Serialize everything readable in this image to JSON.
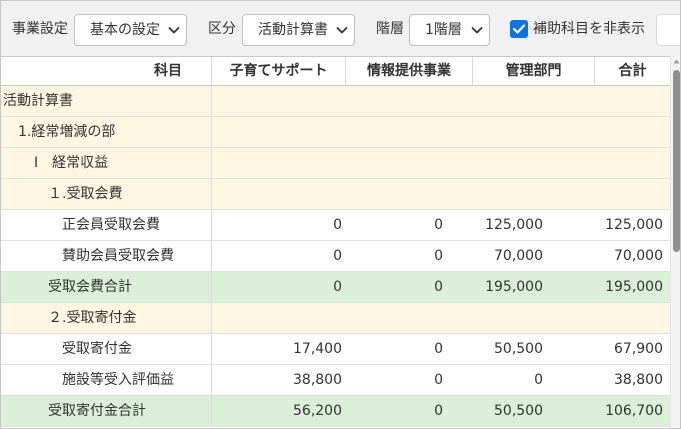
{
  "toolbar": {
    "business_setting": {
      "label": "事業設定",
      "value": "基本の設定"
    },
    "category": {
      "label": "区分",
      "value": "活動計算書"
    },
    "level": {
      "label": "階層",
      "value": "1階層"
    },
    "hide_sub_accounts": {
      "label": "補助科目を非表示",
      "checked": true
    }
  },
  "table": {
    "columns": [
      "科目",
      "子育てサポート",
      "情報提供事業",
      "管理部門",
      "合計"
    ],
    "rows": [
      {
        "label": "活動計算書"
      },
      {
        "label": "1.経常増減の部"
      },
      {
        "label": "Ⅰ　経常収益"
      },
      {
        "label": "１.受取会費"
      },
      {
        "label": "正会員受取会費",
        "values": [
          "0",
          "0",
          "125,000",
          "125,000"
        ]
      },
      {
        "label": "賛助会員受取会費",
        "values": [
          "0",
          "0",
          "70,000",
          "70,000"
        ]
      },
      {
        "label": "受取会費合計",
        "values": [
          "0",
          "0",
          "195,000",
          "195,000"
        ]
      },
      {
        "label": "２.受取寄付金"
      },
      {
        "label": "受取寄付金",
        "values": [
          "17,400",
          "0",
          "50,500",
          "67,900"
        ]
      },
      {
        "label": "施設等受入評価益",
        "values": [
          "38,800",
          "0",
          "0",
          "38,800"
        ]
      },
      {
        "label": "受取寄付金合計",
        "values": [
          "56,200",
          "0",
          "50,500",
          "106,700"
        ]
      }
    ]
  },
  "colors": {
    "section_row": "#fdf6e2",
    "subtotal_row": "#dcefd8",
    "checkbox": "#0b72e7"
  }
}
